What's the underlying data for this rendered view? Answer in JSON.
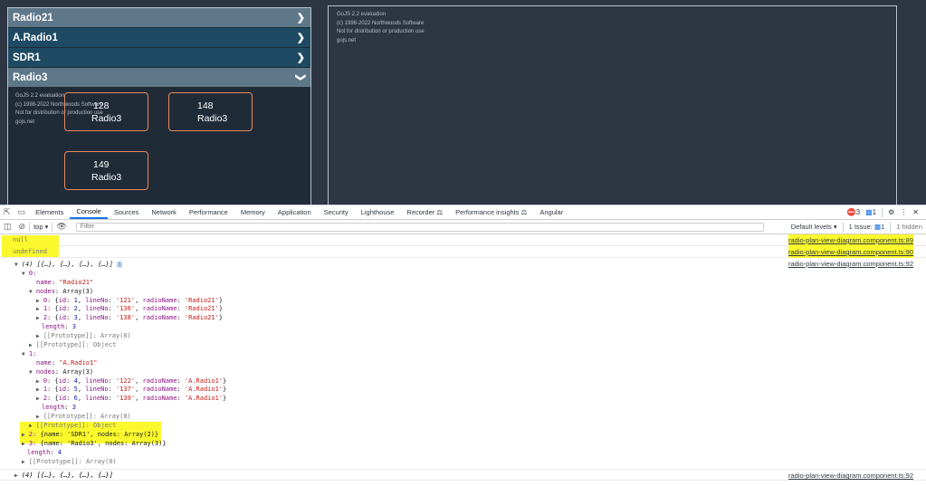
{
  "accordion": {
    "items": [
      {
        "label": "Radio21",
        "chevron": "chevron-right-icon"
      },
      {
        "label": "A.Radio1",
        "chevron": "chevron-right-icon"
      },
      {
        "label": "SDR1",
        "chevron": "chevron-right-icon"
      },
      {
        "label": "Radio3",
        "chevron": "chevron-down-icon"
      }
    ],
    "watermark": [
      "GoJS 2.2 evaluation",
      "(c) 1998-2022 Northwoods Software",
      "Not for distribution or production use",
      "gojs.net"
    ],
    "nodes": [
      {
        "id": "128",
        "name": "Radio3"
      },
      {
        "id": "148",
        "name": "Radio3"
      },
      {
        "id": "149",
        "name": "Radio3"
      }
    ]
  },
  "diagram": {
    "watermark": [
      "GoJS 2.2 evaluation",
      "(c) 1998-2022 Northwoods Software",
      "Not for distribution or production use",
      "gojs.net"
    ]
  },
  "devtools": {
    "tabs": [
      "Elements",
      "Console",
      "Sources",
      "Network",
      "Performance",
      "Memory",
      "Application",
      "Security",
      "Lighthouse",
      "Recorder",
      "Performance insights",
      "Angular"
    ],
    "active_tab": "Console",
    "error_count": "3",
    "message_count": "1",
    "toolbar": {
      "context": "top",
      "filter_placeholder": "Filter",
      "levels": "Default levels",
      "issues": "1 Issue:",
      "issues_count": "1",
      "hidden": "1 hidden"
    },
    "logs": [
      {
        "text": "null",
        "source": "radio-plan-view-diagram.component.ts:89"
      },
      {
        "text": "undefined",
        "source": "radio-plan-view-diagram.component.ts:90"
      }
    ],
    "array_log": {
      "summary": "(4) [{…}, {…}, {…}, {…}]",
      "source": "radio-plan-view-diagram.component.ts:92",
      "bottom_summary": "(4) [{…}, {…}, {…}, {…}]",
      "bottom_source": "radio-plan-view-diagram.component.ts:92",
      "items": [
        {
          "index": "0",
          "name": "\"Radio21\"",
          "nodes_label": "Array(3)",
          "nodes": [
            {
              "i": "0",
              "id": "1",
              "lineNo": "'121'",
              "radioName": "'Radio21'"
            },
            {
              "i": "1",
              "id": "2",
              "lineNo": "'136'",
              "radioName": "'Radio21'"
            },
            {
              "i": "2",
              "id": "3",
              "lineNo": "'138'",
              "radioName": "'Radio21'"
            }
          ],
          "length": "3"
        },
        {
          "index": "1",
          "name": "\"A.Radio1\"",
          "nodes_label": "Array(3)",
          "nodes": [
            {
              "i": "0",
              "id": "4",
              "lineNo": "'122'",
              "radioName": "'A.Radio1'"
            },
            {
              "i": "1",
              "id": "5",
              "lineNo": "'137'",
              "radioName": "'A.Radio1'"
            },
            {
              "i": "2",
              "id": "6",
              "lineNo": "'139'",
              "radioName": "'A.Radio1'"
            }
          ],
          "length": "3"
        }
      ],
      "collapsed": [
        {
          "index": "2",
          "text": "{name: 'SDR1', nodes: Array(2)}"
        },
        {
          "index": "3",
          "text": "{name: 'Radio3', nodes: Array(3)}"
        }
      ],
      "length": "4",
      "prototype_array0": "[[Prototype]]: Array(0)",
      "prototype_object": "[[Prototype]]: Object"
    }
  }
}
